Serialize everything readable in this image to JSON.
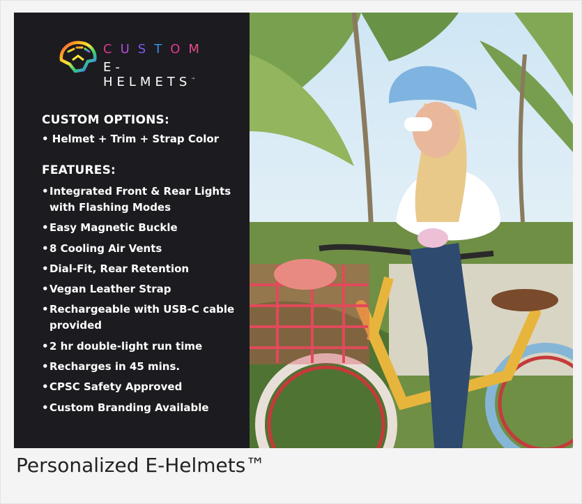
{
  "logo": {
    "top_letters": [
      "C",
      "U",
      "S",
      "T",
      "O",
      "M"
    ],
    "bottom_text": "E-HELMETS",
    "trademark": "™"
  },
  "custom_options": {
    "title": "CUSTOM OPTIONS:",
    "item": "• Helmet + Trim + Strap Color"
  },
  "features": {
    "title": "FEATURES:",
    "items": [
      "Integrated Front & Rear Lights with Flashing Modes",
      "Easy Magnetic Buckle",
      "8 Cooling Air Vents",
      "Dial-Fit, Rear Retention",
      "Vegan Leather Strap",
      "Rechargeable with USB-C cable provided",
      "2 hr double-light run time",
      "Recharges in 45 mins.",
      "CPSC Safety Approved",
      "Custom Branding Available"
    ]
  },
  "caption": "Personalized E-Helmets™",
  "colors": {
    "panel": "#1c1b1f",
    "text": "#ffffff",
    "caption": "#222222"
  },
  "icons": {
    "logo": "rainbow-helmet-icon"
  }
}
